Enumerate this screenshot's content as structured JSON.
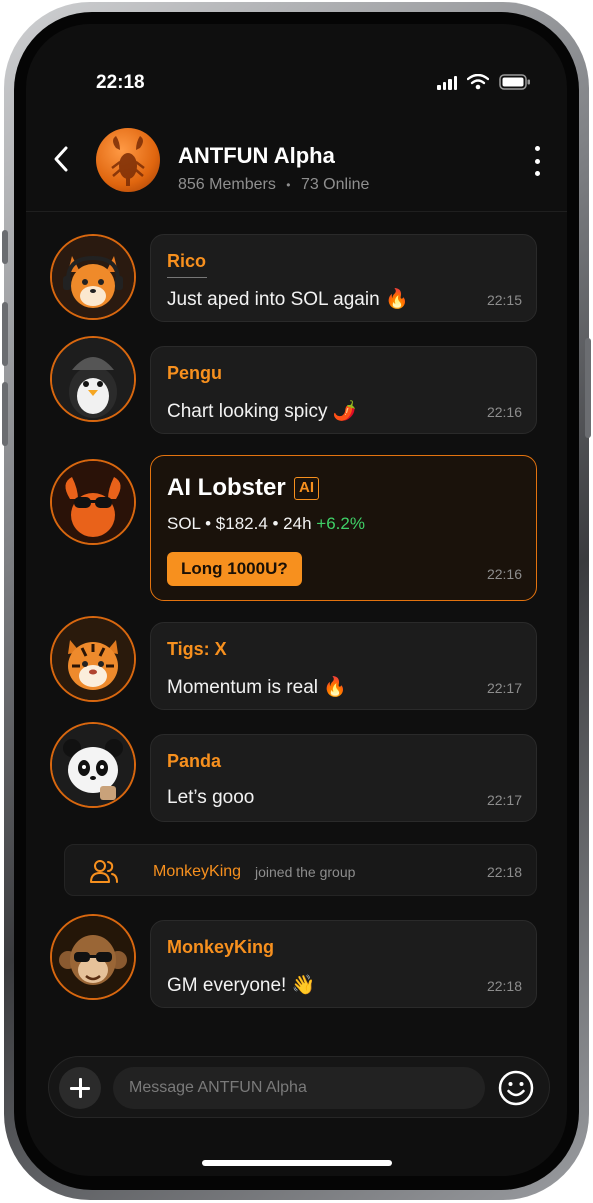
{
  "status": {
    "time": "22:18"
  },
  "header": {
    "title": "ANTFUN Alpha",
    "members": "856 Members",
    "online": "73 Online",
    "separator": "•"
  },
  "messages": [
    {
      "sender": "Rico",
      "text": "Just aped into SOL again 🔥",
      "time": "22:15"
    },
    {
      "sender": "Pengu",
      "text": "Chart looking spicy 🌶️",
      "time": "22:16"
    },
    {
      "sender": "AI Lobster",
      "badge": "AI",
      "line_prefix": "SOL • $182.4 • 24h",
      "change": "+6.2%",
      "action": "Long 1000U?",
      "time": "22:16"
    },
    {
      "sender": "Tigs: X",
      "text": "Momentum is real 🔥",
      "time": "22:17"
    },
    {
      "sender": "Panda",
      "text": "Let’s gooo",
      "time": "22:17"
    },
    {
      "sender": "MonkeyKing",
      "text": "GM everyone! 👋",
      "time": "22:18"
    }
  ],
  "system": {
    "name": "MonkeyKing",
    "text": "joined the group",
    "time": "22:18"
  },
  "composer": {
    "placeholder": "Message ANTFUN Alpha"
  },
  "colors": {
    "accent": "#F7901E",
    "background": "#0F0F0F",
    "bubble": "#1C1C1C",
    "positive": "#3FD067"
  },
  "icons": [
    "back-icon",
    "more-icon",
    "signal-icon",
    "wifi-icon",
    "battery-icon",
    "users-icon",
    "plus-icon",
    "emoji-icon"
  ]
}
